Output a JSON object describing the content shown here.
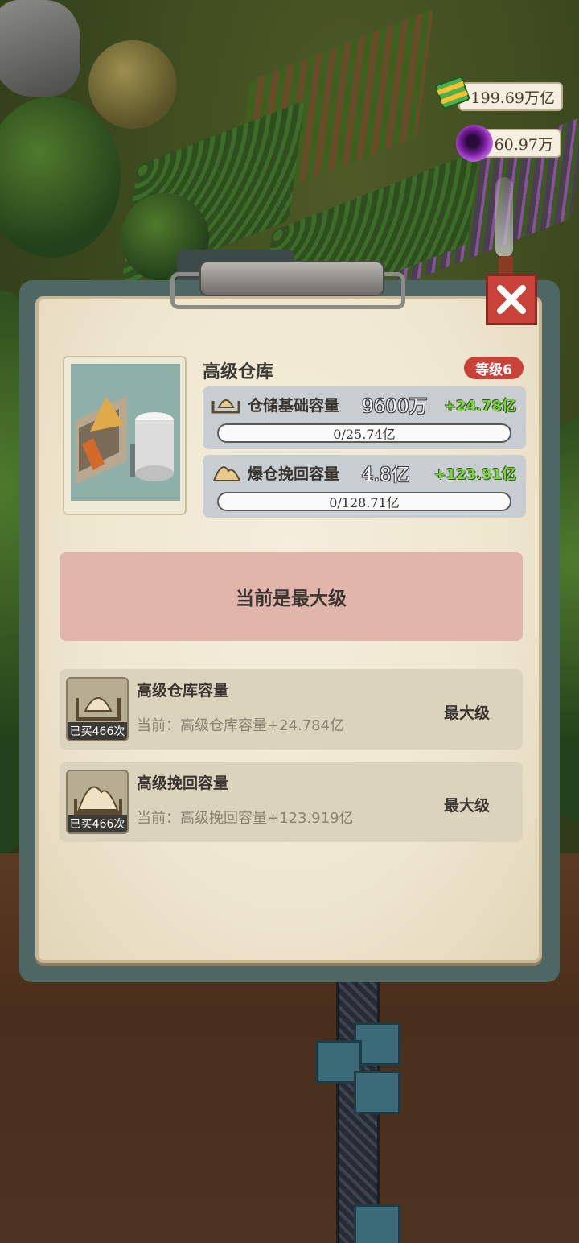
{
  "currencies": {
    "cash": "199.69万亿",
    "gems": "60.97万"
  },
  "building": {
    "name": "高级仓库",
    "level_badge": "等级6"
  },
  "stats": [
    {
      "label": "仓储基础容量",
      "value": "9600万",
      "bonus": "+24.78亿",
      "progress_text": "0/25.74亿",
      "progress_fraction": 0
    },
    {
      "label": "爆仓挽回容量",
      "value": "4.8亿",
      "bonus": "+123.91亿",
      "progress_text": "0/128.71亿",
      "progress_fraction": 0
    }
  ],
  "max_banner": "当前是最大级",
  "upgrades": [
    {
      "title": "高级仓库容量",
      "desc": "当前：高级仓库容量+24.784亿",
      "bought": "已买466次",
      "status": "最大级"
    },
    {
      "title": "高级挽回容量",
      "desc": "当前：高级挽回容量+123.919亿",
      "bought": "已买466次",
      "status": "最大级"
    }
  ],
  "icons": {
    "close": "close-icon",
    "cash": "cash-icon",
    "gem": "gem-icon",
    "storage": "storage-tray-icon",
    "overflow": "overflow-pile-icon"
  },
  "colors": {
    "accent_red": "#c9423a",
    "bonus_green": "#7bd34a",
    "panel_teal": "#4e6664",
    "paper": "#efe6cf"
  }
}
